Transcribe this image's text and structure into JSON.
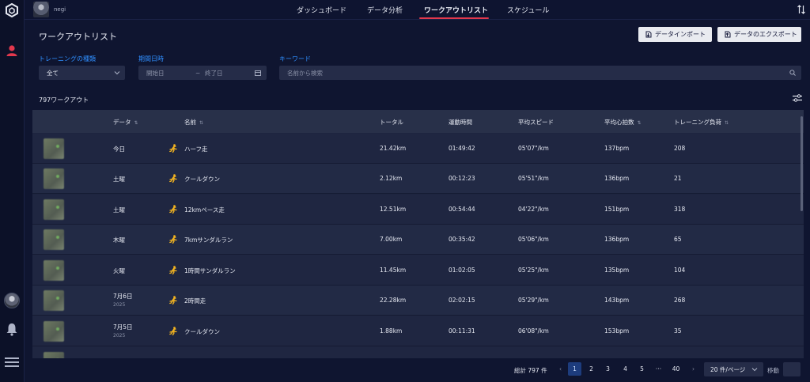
{
  "user": {
    "name": "negi"
  },
  "nav": {
    "tabs": [
      {
        "label": "ダッシュボード"
      },
      {
        "label": "データ分析"
      },
      {
        "label": "ワークアウトリスト"
      },
      {
        "label": "スケジュール"
      }
    ],
    "active": 2
  },
  "page": {
    "title": "ワークアウトリスト",
    "import_label": "データインポート",
    "export_label": "データのエクスポート"
  },
  "filters": {
    "type_label": "トレーニングの種類",
    "type_value": "全て",
    "period_label": "期間日時",
    "start_placeholder": "開始日",
    "end_placeholder": "終了日",
    "tilde": "~",
    "keyword_label": "キーワード",
    "keyword_placeholder": "名前から検索"
  },
  "count_text": "797ワークアウト",
  "table": {
    "headers": {
      "date": "データ",
      "name": "名前",
      "total": "トータル",
      "time": "運動時間",
      "speed": "平均スピード",
      "hr": "平均心拍数",
      "load": "トレーニング負荷"
    },
    "rows": [
      {
        "date": "今日",
        "year": "",
        "name": "ハーフ走",
        "total": "21.42km",
        "time": "01:49:42",
        "speed": "05'07\"/km",
        "hr": "137bpm",
        "load": "208"
      },
      {
        "date": "土曜",
        "year": "",
        "name": "クールダウン",
        "total": "2.12km",
        "time": "00:12:23",
        "speed": "05'51\"/km",
        "hr": "136bpm",
        "load": "21"
      },
      {
        "date": "土曜",
        "year": "",
        "name": "12kmペース走",
        "total": "12.51km",
        "time": "00:54:44",
        "speed": "04'22\"/km",
        "hr": "151bpm",
        "load": "318"
      },
      {
        "date": "木曜",
        "year": "",
        "name": "7kmサンダルラン",
        "total": "7.00km",
        "time": "00:35:42",
        "speed": "05'06\"/km",
        "hr": "136bpm",
        "load": "65"
      },
      {
        "date": "火曜",
        "year": "",
        "name": "1時間サンダルラン",
        "total": "11.45km",
        "time": "01:02:05",
        "speed": "05'25\"/km",
        "hr": "135bpm",
        "load": "104"
      },
      {
        "date": "7月6日",
        "year": "2025",
        "name": "2時間走",
        "total": "22.28km",
        "time": "02:02:15",
        "speed": "05'29\"/km",
        "hr": "143bpm",
        "load": "268"
      },
      {
        "date": "7月5日",
        "year": "2025",
        "name": "クールダウン",
        "total": "1.88km",
        "time": "00:11:31",
        "speed": "06'08\"/km",
        "hr": "153bpm",
        "load": "35"
      }
    ]
  },
  "pagination": {
    "total_text": "総計 797 件",
    "prev": "‹",
    "next": "›",
    "pages": [
      "1",
      "2",
      "3",
      "4",
      "5",
      "···",
      "40"
    ],
    "active_page": "1",
    "page_size": "20 件/ページ",
    "jump_label": "移動"
  },
  "colors": {
    "accent": "#2f8fff",
    "active_tab": "#e2384d",
    "run_icon": "#f5b51f",
    "user_icon": "#e2384d"
  }
}
